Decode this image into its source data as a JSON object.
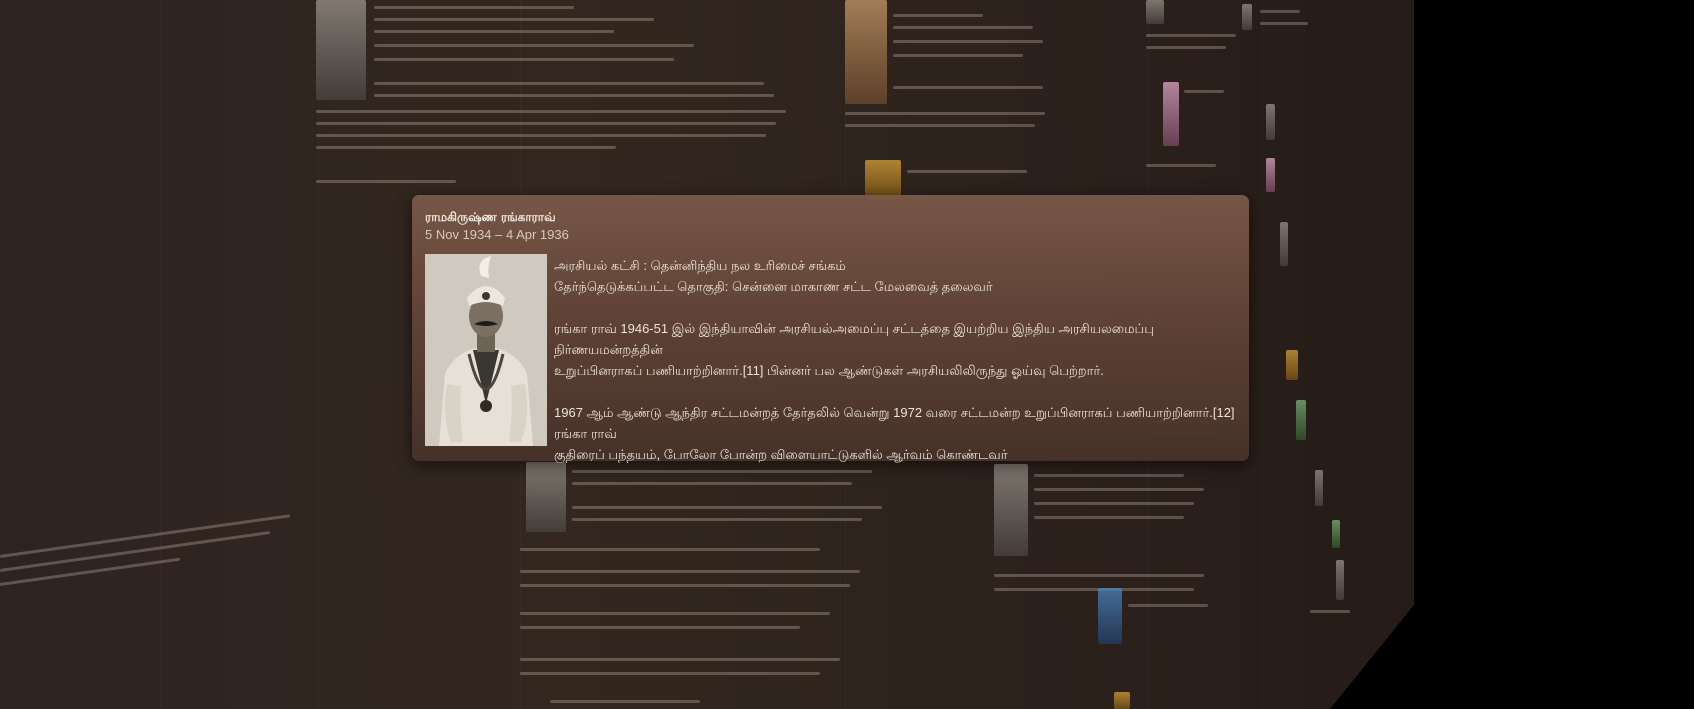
{
  "card": {
    "name": "ராமகிருஷ்ண ரங்காராவ்",
    "dates": "5 Nov 1934 – 4 Apr 1936",
    "party": "அரசியல் கட்சி : தென்னிந்திய நல உரிமைச் சங்கம்",
    "constituency": "தேர்ந்தெடுக்கப்பட்ட தொகுதி: சென்னை மாகாண சட்ட மேலவைத் தலைவர்",
    "para1_line1": "ரங்கா ராவ் 1946-51 இல் இந்தியாவின் அரசியல்அமைப்பு சட்டத்தை இயற்றிய இந்திய அரசியலமைப்பு நிர்ணயமன்றத்தின்",
    "para1_line2": "உறுப்பினராகப் பணியாற்றினார்.[11] பின்னர் பல ஆண்டுகள் அரசியலிலிருந்து ஓய்வு பெற்றார்.",
    "para2_line1": "1967 ஆம் ஆண்டு ஆந்திர சட்டமன்றத் தேர்தலில் வென்று 1972 வரை சட்டமன்ற உறுப்பினராகப் பணியாற்றினார்.[12] ரங்கா ராவ்",
    "para2_line2": "குதிரைப் பந்தயம், போலோ போன்ற விளையாட்டுகளில் ஆர்வம் கொண்டவர்",
    "portrait_icon": "portrait-photo"
  },
  "colors": {
    "wall": "#33271f",
    "card_top": "#7a5848",
    "card_bottom": "#46322a",
    "text": "#eee3d8"
  }
}
